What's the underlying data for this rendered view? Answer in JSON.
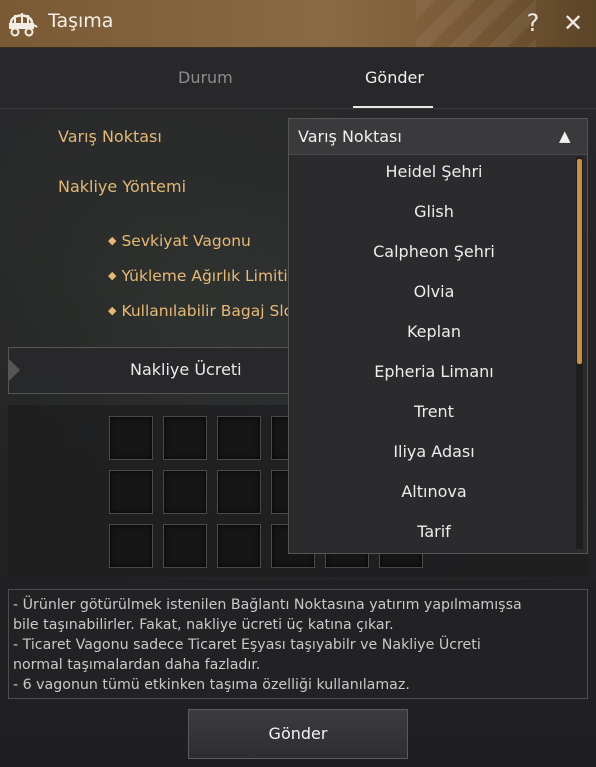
{
  "window": {
    "title": "Taşıma",
    "help": "?",
    "close": "✕"
  },
  "tabs": [
    {
      "label": "Durum"
    },
    {
      "label": "Gönder"
    }
  ],
  "form": {
    "destination_label": "Varış Noktası",
    "method_label": "Nakliye Yöntemi",
    "bullets": [
      {
        "label": "Sevkiyat Vagonu"
      },
      {
        "label": "Yükleme Ağırlık Limiti"
      },
      {
        "label": "Kullanılabilir Bagaj Slo"
      }
    ],
    "fee_label": "Nakliye Ücreti"
  },
  "dropdown": {
    "selected": "Varış Noktası",
    "arrow": "▲",
    "options": [
      "Heidel Şehri",
      "Glish",
      "Calpheon Şehri",
      "Olvia",
      "Keplan",
      "Epheria Limanı",
      "Trent",
      "Iliya Adası",
      "Altınova",
      "Tarif"
    ]
  },
  "notes": [
    "- Ürünler götürülmek istenilen Bağlantı Noktasına yatırım yapılmamışsa",
    "bile taşınabilirler. Fakat, nakliye ücreti üç katına çıkar.",
    "- Ticaret Vagonu sadece Ticaret Eşyası taşıyabilr ve Nakliye Ücreti",
    "normal taşımalardan daha fazladır.",
    "- 6 vagonun tümü etkinken taşıma özelliği kullanılamaz."
  ],
  "send_button": "Gönder",
  "icons": {
    "title": "wagon-icon",
    "bullet": "diamond-icon"
  },
  "colors": {
    "accent_gold": "#e3b877",
    "title_bar": "#8a6a42",
    "scroll_thumb": "#c98f4a"
  }
}
